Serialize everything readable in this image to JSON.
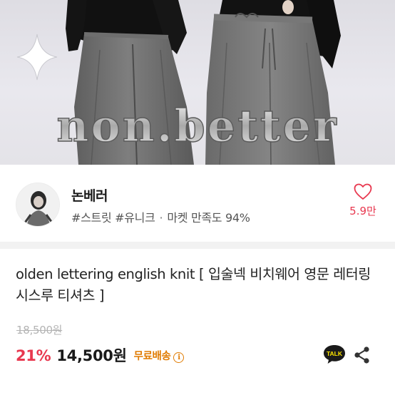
{
  "hero": {
    "brand_watermark": "non.better"
  },
  "shop": {
    "name": "논베러",
    "tags": "#스트릿 #유니크",
    "satisfaction": "마켓 만족도 94%",
    "like_count": "5.9만"
  },
  "product": {
    "title": "olden lettering english knit [ 입술넥 비치웨어 영문 레터링 시스루 티셔츠 ]",
    "original_price": "18,500원",
    "discount_rate": "21%",
    "price": "14,500원",
    "shipping_label": "무료배송"
  },
  "actions": {
    "talk_label": "TALK"
  },
  "icons": {
    "sparkle": "sparkle-icon",
    "heart": "heart-icon",
    "info": "info-icon",
    "talk": "kakao-talk-icon",
    "share": "share-icon"
  },
  "colors": {
    "accent_red": "#e8384f",
    "shipping_orange": "#e07b00",
    "kakao_yellow": "#fee500"
  }
}
